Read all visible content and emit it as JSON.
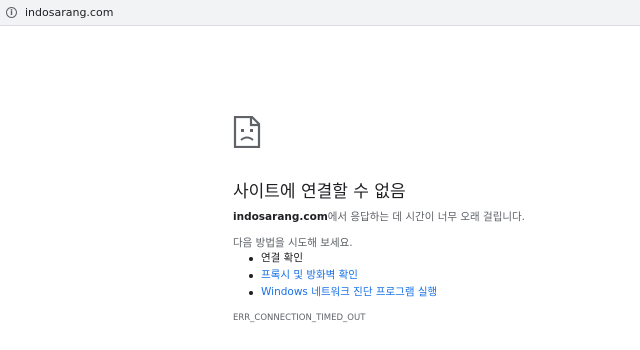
{
  "addressbar": {
    "url": "indosarang.com"
  },
  "error": {
    "icon": "sad-page-icon",
    "title": "사이트에 연결할 수 없음",
    "host": "indosarang.com",
    "message_suffix": "에서 응답하는 데 시간이 너무 오래 걸립니다.",
    "try_label": "다음 방법을 시도해 보세요.",
    "suggestions": [
      {
        "label": "연결 확인",
        "link": false
      },
      {
        "label": "프록시 및 방화벽 확인",
        "link": true
      },
      {
        "label": "Windows 네트워크 진단 프로그램 실행",
        "link": true
      }
    ],
    "code": "ERR_CONNECTION_TIMED_OUT"
  },
  "colors": {
    "link": "#1a73e8",
    "text": "#202124",
    "secondary_text": "#5f6368",
    "toolbar": "#f1f3f4"
  }
}
